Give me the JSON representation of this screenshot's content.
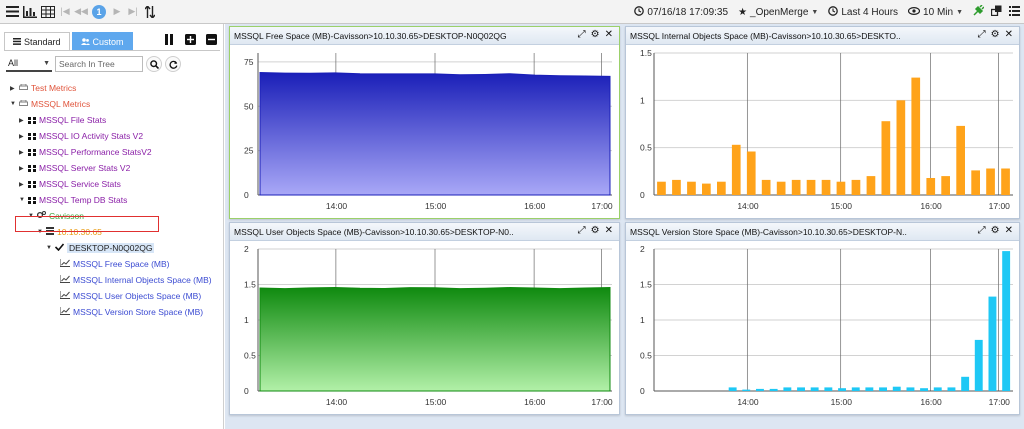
{
  "toolbar": {
    "page_number": "1",
    "datetime": "07/16/18 17:09:35",
    "favorite": "_OpenMerge",
    "range": "Last 4 Hours",
    "interval": "10 Min"
  },
  "left": {
    "tabs": [
      {
        "label": "Standard"
      },
      {
        "label": "Custom"
      }
    ],
    "filter_value": "All",
    "search_placeholder": "Search In Tree",
    "tree": [
      {
        "label": "Test Metrics"
      },
      {
        "label": "MSSQL Metrics"
      },
      {
        "label": "MSSQL File Stats"
      },
      {
        "label": "MSSQL IO Activity Stats V2"
      },
      {
        "label": "MSSQL Performance StatsV2"
      },
      {
        "label": "MSSQL Server Stats V2"
      },
      {
        "label": "MSSQL Service Stats"
      },
      {
        "label": "MSSQL Temp DB Stats"
      },
      {
        "label": "Cavisson"
      },
      {
        "label": "10.10.30.65"
      },
      {
        "label": "DESKTOP-N0Q02QG"
      },
      {
        "label": "MSSQL Free Space (MB)"
      },
      {
        "label": "MSSQL Internal Objects Space (MB)"
      },
      {
        "label": "MSSQL User Objects Space (MB)"
      },
      {
        "label": "MSSQL Version Store Space (MB)"
      }
    ]
  },
  "colors": {
    "accent": "#5fa8ee",
    "free_space_top": "#1a1fb8",
    "free_space_bottom": "#a9a8f7",
    "user_objects_top": "#0f8a0f",
    "user_objects_bottom": "#b2f0a8",
    "internal_bars": "#ffa31a",
    "version_bars": "#1ec8f5"
  },
  "panels": [
    {
      "title": "MSSQL Free Space (MB)-Cavisson>10.10.30.65>DESKTOP-N0Q02QG"
    },
    {
      "title": "MSSQL Internal Objects Space (MB)-Cavisson>10.10.30.65>DESKTO.."
    },
    {
      "title": "MSSQL User Objects Space (MB)-Cavisson>10.10.30.65>DESKTOP-N0.."
    },
    {
      "title": "MSSQL Version Store Space (MB)-Cavisson>10.10.30.65>DESKTOP-N.."
    }
  ],
  "chart_data": [
    {
      "type": "area",
      "title": "MSSQL Free Space (MB)-Cavisson>10.10.30.65>DESKTOP-N0Q02QG",
      "x_ticks": [
        "14:00",
        "15:00",
        "16:00",
        "17:00"
      ],
      "y_ticks": [
        "0",
        "25",
        "50",
        "75"
      ],
      "ylim": [
        0,
        80
      ],
      "grid": true,
      "series": [
        {
          "values": [
            69,
            69,
            68.5,
            68.5,
            68.5,
            68.5,
            68,
            68,
            68,
            68,
            68,
            67.5,
            67.5,
            67,
            66.5
          ]
        }
      ]
    },
    {
      "type": "bar",
      "title": "MSSQL Internal Objects Space (MB)-Cavisson>10.10.30.65>DESKTO..",
      "x_ticks": [
        "14:00",
        "15:00",
        "16:00",
        "17:00"
      ],
      "y_ticks": [
        "0",
        "0.5",
        "1",
        "1.5"
      ],
      "ylim": [
        0,
        1.5
      ],
      "grid": true,
      "values": [
        0.14,
        0.16,
        0.14,
        0.12,
        0.14,
        0.53,
        0.46,
        0.16,
        0.14,
        0.16,
        0.16,
        0.16,
        0.14,
        0.16,
        0.2,
        0.78,
        1.0,
        1.24,
        0.18,
        0.2,
        0.73,
        0.26,
        0.28,
        0.28
      ]
    },
    {
      "type": "area",
      "title": "MSSQL User Objects Space (MB)-Cavisson>10.10.30.65>DESKTOP-N0..",
      "x_ticks": [
        "14:00",
        "15:00",
        "16:00",
        "17:00"
      ],
      "y_ticks": [
        "0",
        "0.5",
        "1",
        "1.5",
        "2"
      ],
      "ylim": [
        0,
        2
      ],
      "grid": true,
      "series": [
        {
          "values": [
            1.45,
            1.45,
            1.45,
            1.45,
            1.45,
            1.45,
            1.45,
            1.45,
            1.45,
            1.45,
            1.45,
            1.45,
            1.45,
            1.45,
            1.45
          ]
        }
      ]
    },
    {
      "type": "bar",
      "title": "MSSQL Version Store Space (MB)-Cavisson>10.10.30.65>DESKTOP-N..",
      "x_ticks": [
        "14:00",
        "15:00",
        "16:00",
        "17:00"
      ],
      "y_ticks": [
        "0",
        "0.5",
        "1",
        "1.5",
        "2"
      ],
      "ylim": [
        0,
        2
      ],
      "grid": true,
      "values": [
        0.05,
        0.02,
        0.03,
        0.03,
        0.05,
        0.05,
        0.05,
        0.05,
        0.04,
        0.05,
        0.05,
        0.05,
        0.06,
        0.05,
        0.04,
        0.05,
        0.05,
        0.2,
        0.72,
        1.33,
        1.97
      ]
    }
  ]
}
